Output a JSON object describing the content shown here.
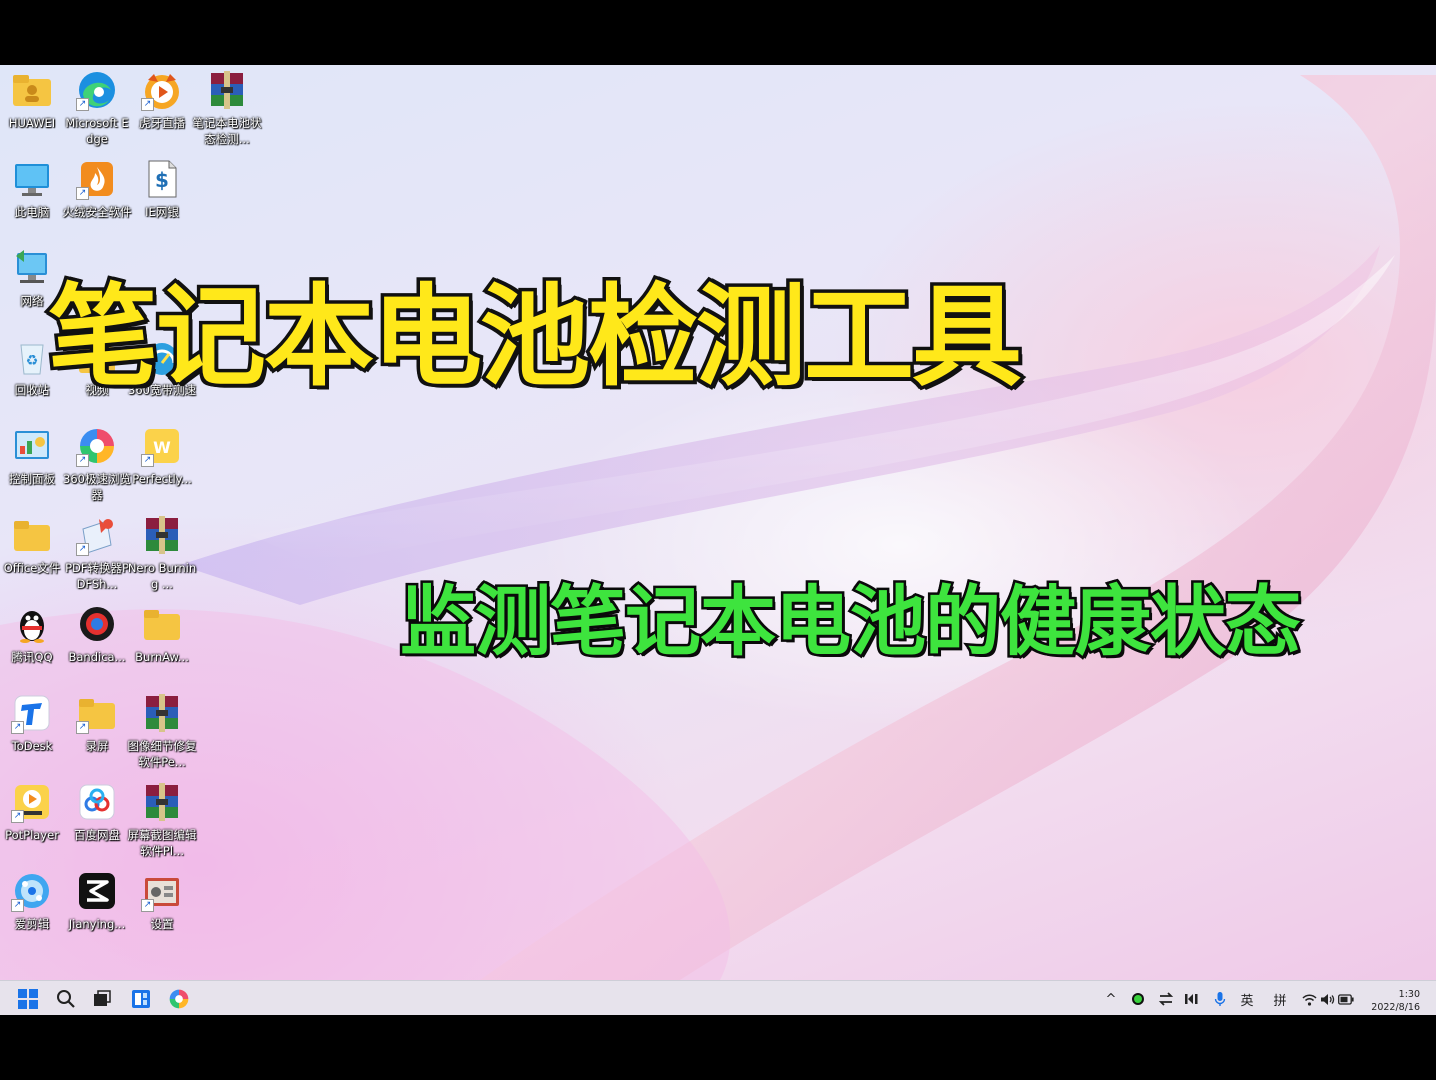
{
  "headline": "笔记本电池检测工具",
  "subline": "监测笔记本电池的健康状态",
  "desktop_icons": [
    {
      "name": "huawei",
      "label": "HUAWEI"
    },
    {
      "name": "edge",
      "label": "Microsoft Edge"
    },
    {
      "name": "huya",
      "label": "虎牙直播"
    },
    {
      "name": "battery-tool",
      "label": "笔记本电池状态检测..."
    },
    {
      "name": "this-pc",
      "label": "此电脑"
    },
    {
      "name": "huorong",
      "label": "火绒安全软件"
    },
    {
      "name": "ie-net",
      "label": "IE网银"
    },
    {
      "name": "network",
      "label": "网络"
    },
    {
      "name": "recycle-bin",
      "label": "回收站"
    },
    {
      "name": "video",
      "label": "视频"
    },
    {
      "name": "360-speed",
      "label": "360宽带测速"
    },
    {
      "name": "control-panel",
      "label": "控制面板"
    },
    {
      "name": "360-browser",
      "label": "360极速浏览器"
    },
    {
      "name": "perfectly",
      "label": "Perfectly..."
    },
    {
      "name": "office-folder",
      "label": "Office文件"
    },
    {
      "name": "pdf-converter",
      "label": "PDF转换器PDFSh..."
    },
    {
      "name": "nero",
      "label": "Nero Burning ..."
    },
    {
      "name": "qq",
      "label": "腾讯QQ"
    },
    {
      "name": "bandicam",
      "label": "Bandica..."
    },
    {
      "name": "burnaw",
      "label": "BurnAw..."
    },
    {
      "name": "todesk",
      "label": "ToDesk"
    },
    {
      "name": "record-folder",
      "label": "录屏"
    },
    {
      "name": "image-repair",
      "label": "图像细节修复软件Pe..."
    },
    {
      "name": "potplayer",
      "label": "PotPlayer"
    },
    {
      "name": "baidu-netdisk",
      "label": "百度网盘"
    },
    {
      "name": "screen-tool",
      "label": "屏幕截图编辑软件Pl..."
    },
    {
      "name": "aijianji",
      "label": "爱剪辑"
    },
    {
      "name": "jianying",
      "label": "Jianying..."
    },
    {
      "name": "settings",
      "label": "设置"
    }
  ],
  "taskbar": {
    "tray_lang": "英",
    "tray_ime": "拼",
    "tray_chevron": "^",
    "time": "1:30",
    "date": "2022/8/16"
  },
  "colors": {
    "headline": "#ffe81a",
    "subline": "#3ee43e",
    "accent": "#1a73e8"
  }
}
